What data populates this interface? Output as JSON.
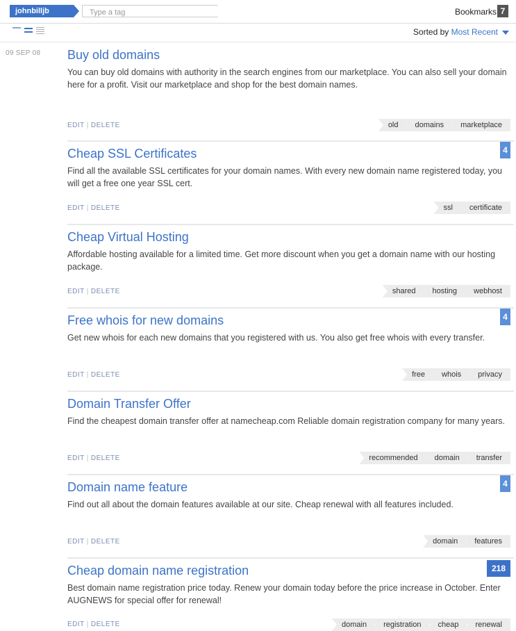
{
  "header": {
    "username": "johnbilljb",
    "tag_placeholder": "Type a tag",
    "bookmarks_label": "Bookmarks",
    "bookmarks_count": "7"
  },
  "sort": {
    "label": "Sorted by",
    "value": "Most Recent"
  },
  "date": "09 SEP 08",
  "action_edit": "EDIT",
  "action_delete": "DELETE",
  "colors": {
    "accent": "#3c73c8",
    "count_badge": "#5b8fd9"
  },
  "bookmarks": [
    {
      "title": "Buy old domains",
      "description": "You can buy old domains with authority in the search engines from our marketplace. You can also sell your domain here for a profit. Visit our marketplace and shop for the best domain names.",
      "tags": [
        "old",
        "domains",
        "marketplace"
      ],
      "count": ""
    },
    {
      "title": "Cheap SSL Certificates",
      "description": "Find all the available SSL certificates for your domain names. With every new domain name registered today, you will get a free one year SSL cert.",
      "tags": [
        "ssl",
        "certificate"
      ],
      "count": "4"
    },
    {
      "title": "Cheap Virtual Hosting",
      "description": "Affordable hosting available for a limited time. Get more discount when you get a domain name with our hosting package.",
      "tags": [
        "shared",
        "hosting",
        "webhost"
      ],
      "count": ""
    },
    {
      "title": "Free whois for new domains",
      "description": "Get new whois for each new domains that you registered with us. You also get free whois with every transfer.",
      "tags": [
        "free",
        "whois",
        "privacy"
      ],
      "count": "4"
    },
    {
      "title": "Domain Transfer Offer",
      "description": "Find the cheapest domain transfer offer at namecheap.com Reliable domain registration company for many years.",
      "tags": [
        "recommended",
        "domain",
        "transfer"
      ],
      "count": ""
    },
    {
      "title": "Domain name feature",
      "description": "Find out all about the domain features available at our site. Cheap renewal with all features included.",
      "tags": [
        "domain",
        "features"
      ],
      "count": "4"
    },
    {
      "title": "Cheap domain name registration",
      "description": "Best domain name registration price today. Renew your domain today before the price increase in October. Enter AUGNEWS for special offer for renewal!",
      "tags": [
        "domain",
        "registration",
        "cheap",
        "renewal"
      ],
      "count": "218"
    }
  ]
}
